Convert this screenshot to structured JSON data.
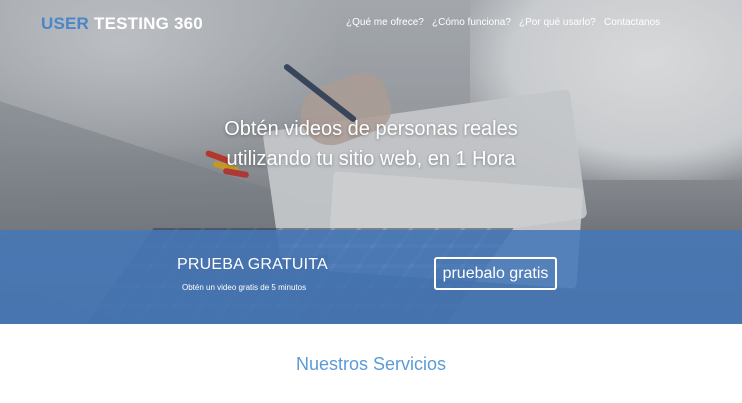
{
  "logo": {
    "part1": "USER",
    "part2": "TESTING 360"
  },
  "nav": {
    "items": [
      {
        "label": "¿Qué me ofrece?"
      },
      {
        "label": "¿Cómo funciona?"
      },
      {
        "label": "¿Por qué usarlo?"
      },
      {
        "label": "Contactanos"
      }
    ]
  },
  "hero": {
    "headline_line1": "Obtén videos de personas reales",
    "headline_line2": "utilizando tu sitio web, en 1 Hora"
  },
  "cta": {
    "title": "PRUEBA GRATUITA",
    "subtitle": "Obtén un video gratis de 5 minutos",
    "button_label": "pruebalo gratis"
  },
  "services": {
    "title": "Nuestros Servicios"
  },
  "colors": {
    "accent_blue": "#4a86c8",
    "band_blue": "#4678b8",
    "services_title": "#5b9bd8"
  }
}
